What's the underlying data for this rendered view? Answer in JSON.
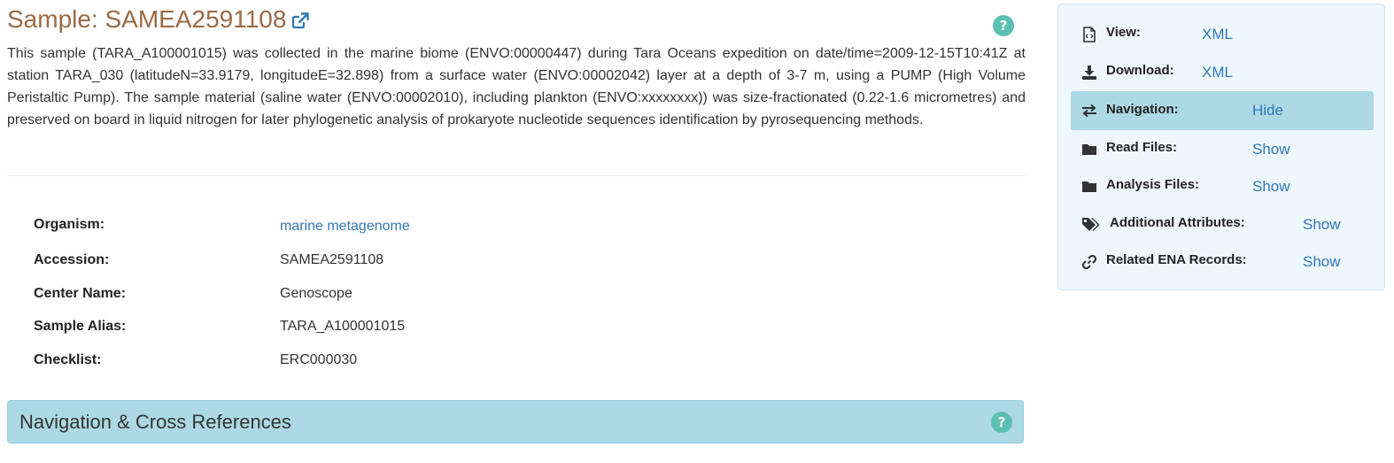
{
  "header": {
    "title": "Sample: SAMEA2591108",
    "help_glyph": "?"
  },
  "description": "This sample (TARA_A100001015) was collected in the marine biome (ENVO:00000447) during Tara Oceans expedition on date/time=2009-12-15T10:41Z at station TARA_030 (latitudeN=33.9179, longitudeE=32.898) from a surface water (ENVO:00002042) layer at a depth of 3-7 m, using a PUMP (High Volume Peristaltic Pump). The sample material (saline water (ENVO:00002010), including plankton (ENVO:xxxxxxxx)) was size-fractionated (0.22-1.6 micrometres) and preserved on board in liquid nitrogen for later phylogenetic analysis of prokaryote nucleotide sequences identification by pyrosequencing methods.",
  "attributes": [
    {
      "label": "Organism:",
      "value": "marine metagenome"
    },
    {
      "label": "Accession:",
      "value": "SAMEA2591108"
    },
    {
      "label": "Center Name:",
      "value": "Genoscope"
    },
    {
      "label": "Sample Alias:",
      "value": "TARA_A100001015"
    },
    {
      "label": "Checklist:",
      "value": "ERC000030"
    }
  ],
  "nav_section": {
    "title": "Navigation & Cross References",
    "help_glyph": "?"
  },
  "side_panel": {
    "rows": [
      {
        "icon": "file-code-icon",
        "label": "View:",
        "value": "XML"
      },
      {
        "icon": "download-icon",
        "label": "Download:",
        "value": "XML"
      },
      {
        "icon": "exchange-icon",
        "label": "Navigation:",
        "value": "Hide"
      },
      {
        "icon": "folder-icon",
        "label": "Read Files:",
        "value": "Show"
      },
      {
        "icon": "folder-icon",
        "label": "Analysis Files:",
        "value": "Show"
      },
      {
        "icon": "tags-icon",
        "label": "Additional Attributes:",
        "value": "Show"
      },
      {
        "icon": "link-icon",
        "label": "Related ENA Records:",
        "value": "Show"
      }
    ]
  },
  "colors": {
    "title_brown": "#9a6a44",
    "link_blue": "#2f78b7",
    "help_teal": "#5cbfb4",
    "nav_bar_blue": "#acd9e5",
    "panel_bg": "#eef7fc"
  }
}
